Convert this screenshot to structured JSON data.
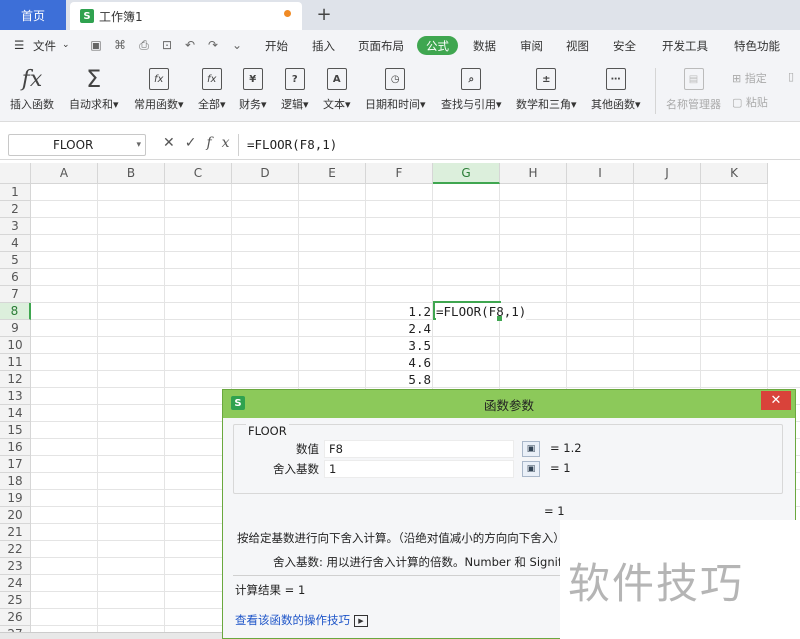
{
  "tabs": {
    "home": "首页",
    "doc": "工作簿1",
    "new": "+"
  },
  "menu": {
    "file": "文件",
    "items": [
      "开始",
      "插入",
      "页面布局",
      "公式",
      "数据",
      "审阅",
      "视图",
      "安全",
      "开发工具",
      "特色功能"
    ],
    "active": "公式"
  },
  "ribbon": {
    "buttons": [
      "插入函数",
      "自动求和",
      "常用函数",
      "全部",
      "财务",
      "逻辑",
      "文本",
      "日期和时间",
      "查找与引用",
      "数学和三角",
      "其他函数"
    ],
    "icon_texts": [
      "fx",
      "Σ",
      "fx",
      "fx",
      "¥",
      "?",
      "A",
      "◷",
      "⌕",
      "±",
      "⋯"
    ],
    "name_manager": "名称管理器",
    "specify": "指定",
    "paste": "粘贴"
  },
  "formula_bar": {
    "name_box": "FLOOR",
    "fx": "fx",
    "content": "=FLOOR(F8,1)"
  },
  "grid": {
    "columns": [
      "A",
      "B",
      "C",
      "D",
      "E",
      "F",
      "G",
      "H",
      "I",
      "J",
      "K"
    ],
    "active_column": "G",
    "rows": [
      "1",
      "2",
      "3",
      "4",
      "5",
      "6",
      "7",
      "8",
      "9",
      "10",
      "11",
      "12",
      "13",
      "14",
      "15",
      "16",
      "17",
      "18",
      "19",
      "20",
      "21",
      "22",
      "23",
      "24",
      "25",
      "26",
      "27"
    ],
    "active_row": "8",
    "f_values": [
      "1.2",
      "2.4",
      "3.5",
      "4.6",
      "5.8"
    ],
    "g8": "=FLOOR(F8,1)"
  },
  "dialog": {
    "title": "函数参数",
    "function": "FLOOR",
    "arg1_label": "数值",
    "arg1_value": "F8",
    "arg1_result": "= 1.2",
    "arg2_label": "舍入基数",
    "arg2_value": "1",
    "arg2_result": "= 1",
    "total_result": "= 1",
    "description": "按给定基数进行向下舍入计算。（沿绝对值减小的方向向下舍入）",
    "arg_description": "舍入基数:  用以进行舍入计算的倍数。Number 和 Significance",
    "calc_result": "计算结果 =  1",
    "help_link": "查看该函数的操作技巧",
    "close": "✕"
  },
  "watermark": "软件技巧",
  "colors": {
    "accent": "#3fa650",
    "title_bar": "#8cc95a",
    "home_tab": "#3d6fd8",
    "close": "#d9433a"
  }
}
